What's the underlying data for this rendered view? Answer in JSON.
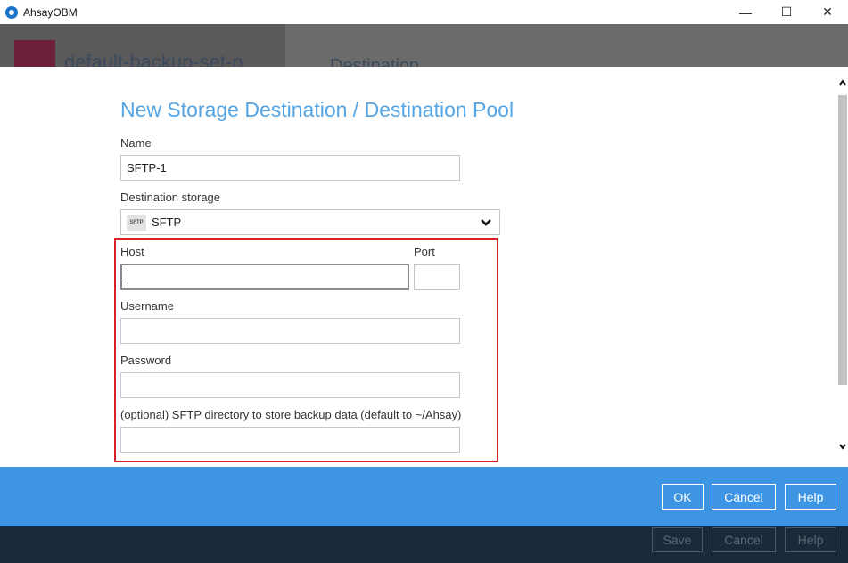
{
  "window": {
    "title": "AhsayOBM",
    "minimize": "—",
    "maximize": "☐",
    "close": "✕"
  },
  "background": {
    "backup_set_name": "default-backup-set-n",
    "section_title": "Destination"
  },
  "dialog": {
    "title": "New Storage Destination / Destination Pool",
    "name_label": "Name",
    "name_value": "SFTP-1",
    "destination_label": "Destination storage",
    "destination_badge": "SFTP",
    "destination_value": "SFTP",
    "host_label": "Host",
    "host_value": "",
    "port_label": "Port",
    "port_value": "",
    "username_label": "Username",
    "username_value": "",
    "password_label": "Password",
    "password_value": "",
    "directory_label": "(optional) SFTP directory to store backup data (default to ~/Ahsay)",
    "directory_value": "",
    "highlight_color": "#d82027"
  },
  "buttons": {
    "ok": "OK",
    "cancel": "Cancel",
    "help": "Help"
  },
  "footer": {
    "save": "Save",
    "cancel": "Cancel",
    "help": "Help"
  },
  "colors": {
    "accent_blue": "#3e95e3",
    "title_blue": "#55a5e4",
    "footer_dark": "#1b2a3b"
  }
}
